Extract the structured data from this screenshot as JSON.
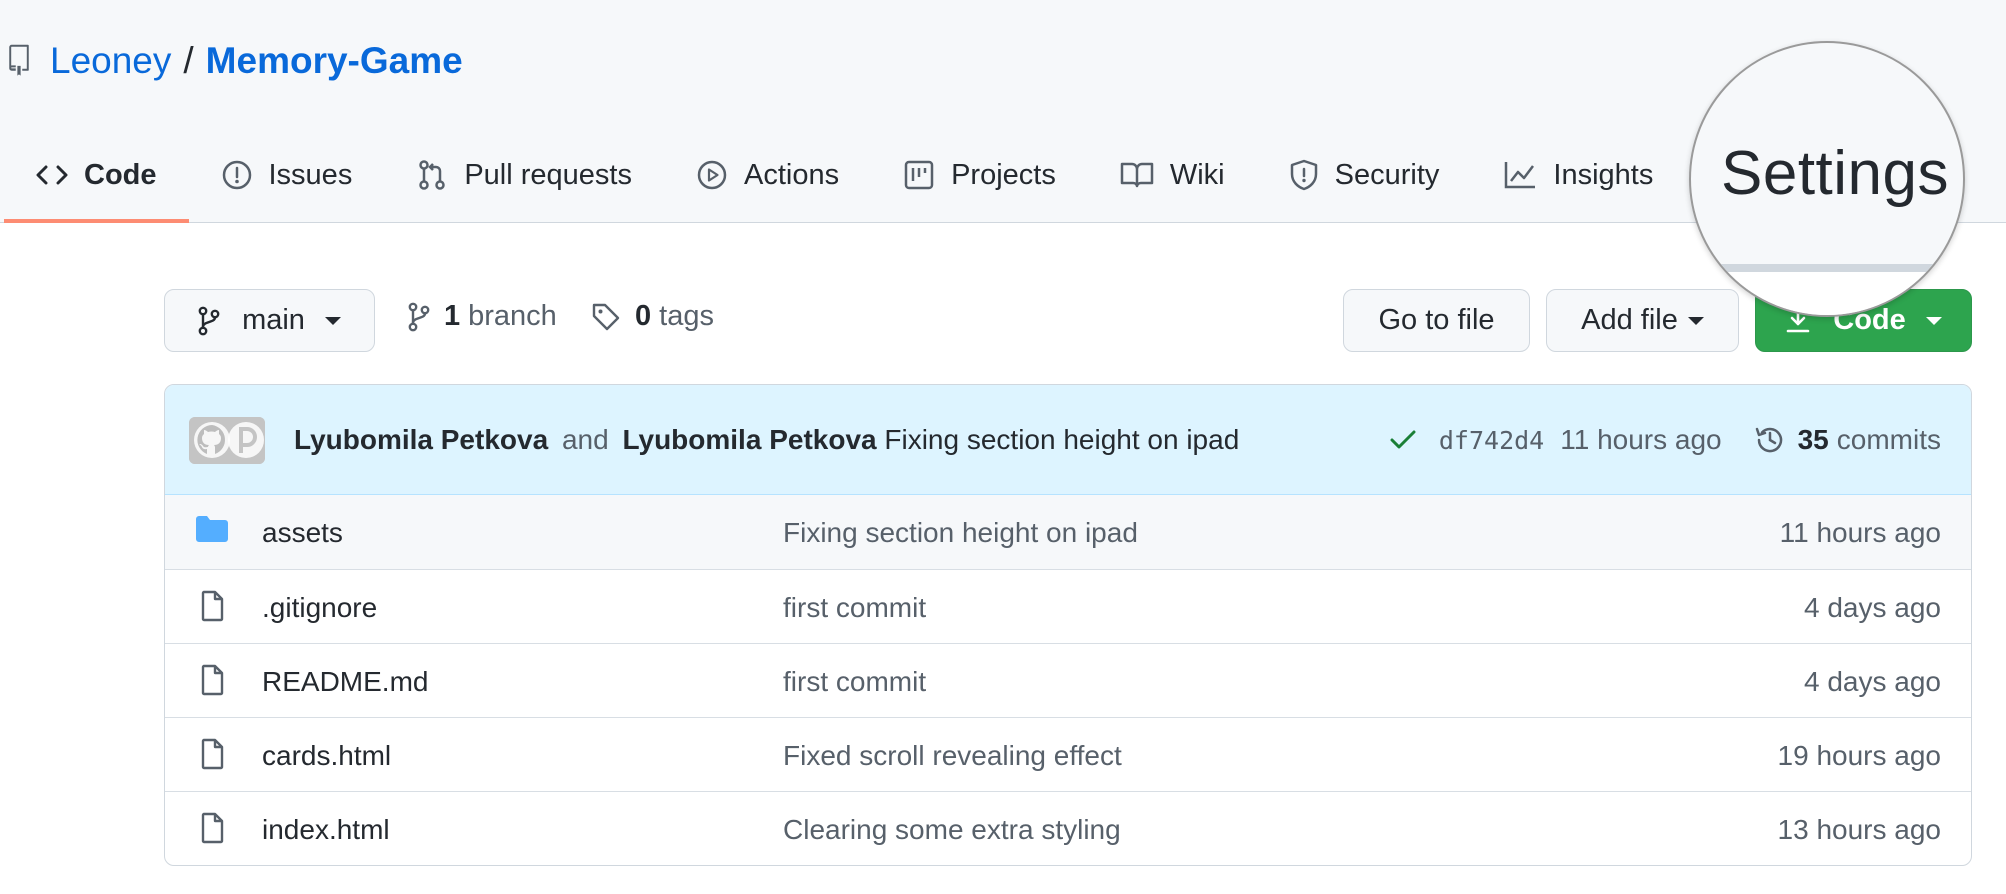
{
  "repo": {
    "owner": "Leoney",
    "separator": "/",
    "name": "Memory-Game"
  },
  "tabs": [
    {
      "label": "Code",
      "icon": "code-icon",
      "active": true
    },
    {
      "label": "Issues",
      "icon": "issue-icon"
    },
    {
      "label": "Pull requests",
      "icon": "pull-request-icon"
    },
    {
      "label": "Actions",
      "icon": "play-icon"
    },
    {
      "label": "Projects",
      "icon": "project-icon"
    },
    {
      "label": "Wiki",
      "icon": "book-icon"
    },
    {
      "label": "Security",
      "icon": "shield-icon"
    },
    {
      "label": "Insights",
      "icon": "graph-icon"
    }
  ],
  "magnifier": {
    "label": "Settings"
  },
  "toolbar": {
    "branch": "main",
    "branch_count": "1",
    "branch_label": "branch",
    "tag_count": "0",
    "tag_label": "tags",
    "goto_file": "Go to file",
    "add_file": "Add file",
    "code": "Code"
  },
  "commit": {
    "author1": "Lyubomila Petkova",
    "and": "and",
    "author2": "Lyubomila Petkova",
    "message": "Fixing section height on ipad",
    "sha": "df742d4",
    "time": "11 hours ago",
    "count": "35",
    "count_label": "commits"
  },
  "files": [
    {
      "name": "assets",
      "type": "dir",
      "message": "Fixing section height on ipad",
      "time": "11 hours ago"
    },
    {
      "name": ".gitignore",
      "type": "file",
      "message": "first commit",
      "time": "4 days ago"
    },
    {
      "name": "README.md",
      "type": "file",
      "message": "first commit",
      "time": "4 days ago"
    },
    {
      "name": "cards.html",
      "type": "file",
      "message": "Fixed scroll revealing effect",
      "time": "19 hours ago"
    },
    {
      "name": "index.html",
      "type": "file",
      "message": "Clearing some extra styling",
      "time": "13 hours ago"
    }
  ],
  "colors": {
    "link": "#0969da",
    "active_tab_underline": "#fd8c73",
    "code_button": "#2da44e",
    "commit_bar": "#ddf4ff",
    "folder": "#54aeff",
    "check": "#1a7f37"
  }
}
